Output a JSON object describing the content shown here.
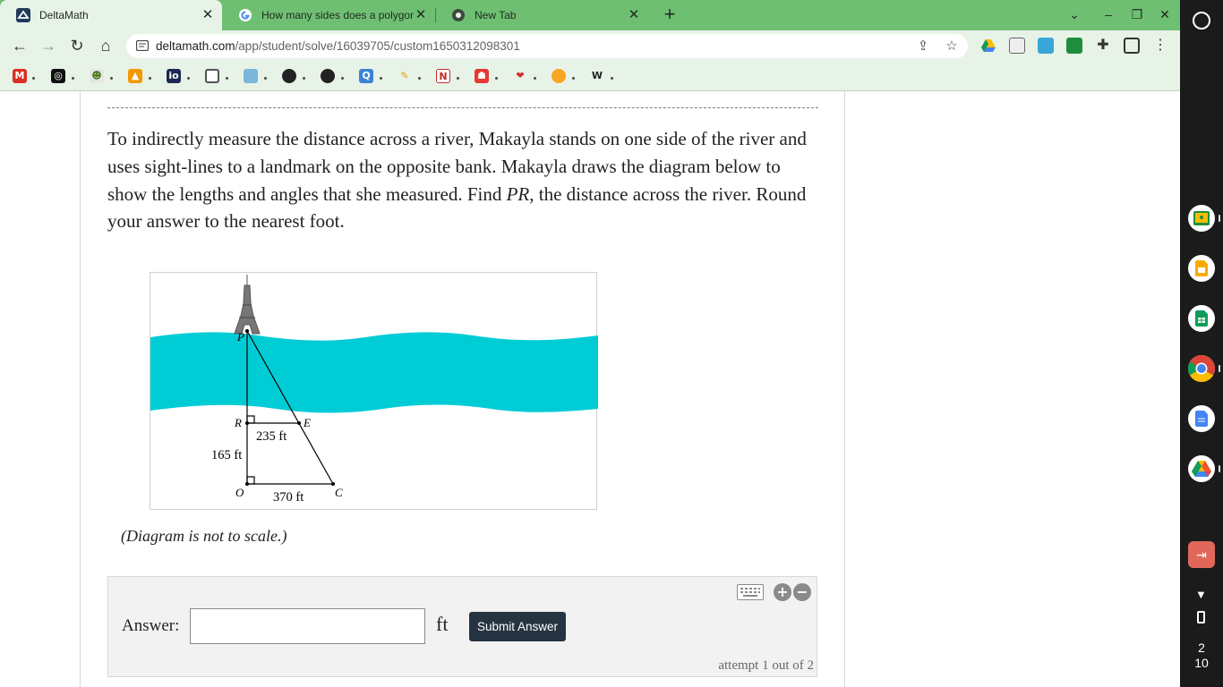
{
  "browser": {
    "tabs": [
      {
        "title": "DeltaMath",
        "icon": "deltamath-favicon",
        "active": true
      },
      {
        "title": "How many sides does a polygon",
        "icon": "google-favicon",
        "active": false
      },
      {
        "title": "New Tab",
        "icon": "chrome-favicon",
        "active": false
      }
    ],
    "url_host": "deltamath.com",
    "url_path": "/app/student/solve/16039705/custom1650312098301",
    "accent": "#6fbf73"
  },
  "problem": {
    "text_before": "To indirectly measure the distance across a river, Makayla stands on one side of the river and uses sight-lines to a landmark on the opposite bank. Makayla draws the diagram below to show the lengths and angles that she measured. Find ",
    "variable": "PR",
    "text_after": ", the distance across the river. Round your answer to the nearest foot."
  },
  "diagram": {
    "points": {
      "P": "P",
      "R": "R",
      "E": "E",
      "O": "O",
      "C": "C"
    },
    "labels": {
      "re": "235 ft",
      "ro": "165 ft",
      "oc": "370 ft"
    },
    "river_color": "#00ccd6",
    "note": "(Diagram is not to scale.)"
  },
  "answer": {
    "label": "Answer:",
    "value": "",
    "unit": "ft",
    "submit_label": "Submit Answer",
    "attempt_text": "attempt 1 out of 2"
  },
  "shelf": {
    "clock_hour": "2",
    "clock_minute": "10"
  }
}
